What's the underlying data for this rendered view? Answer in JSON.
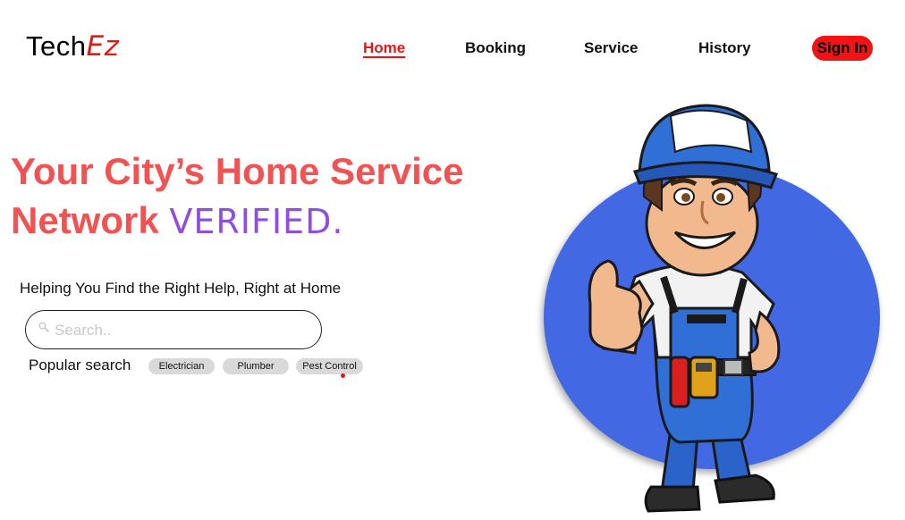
{
  "brand": {
    "logo_main": "Tech",
    "logo_accent": "Ez"
  },
  "nav": {
    "items": [
      {
        "label": "Home",
        "active": true
      },
      {
        "label": "Booking",
        "active": false
      },
      {
        "label": "Service",
        "active": false
      },
      {
        "label": "History",
        "active": false
      }
    ],
    "signin_label": "Sign In"
  },
  "hero": {
    "line1": "Your City’s Home Service",
    "line2_main": "Network",
    "line2_accent": "VERIFIED.",
    "subtitle": "Helping You Find the Right Help, Right at Home"
  },
  "search": {
    "placeholder": "Search..",
    "value": ""
  },
  "popular": {
    "label": "Popular search",
    "chips": [
      "Electrician",
      "Plumber",
      "Pest Control"
    ]
  },
  "colors": {
    "brand_red": "#e51616",
    "headline_coral": "#f25252",
    "accent_purple": "#8e4ee4",
    "circle_blue": "#4368e3",
    "chip_gray": "#d9d9d9"
  },
  "illustration": {
    "icon": "technician-thumbs-up-illustration"
  }
}
